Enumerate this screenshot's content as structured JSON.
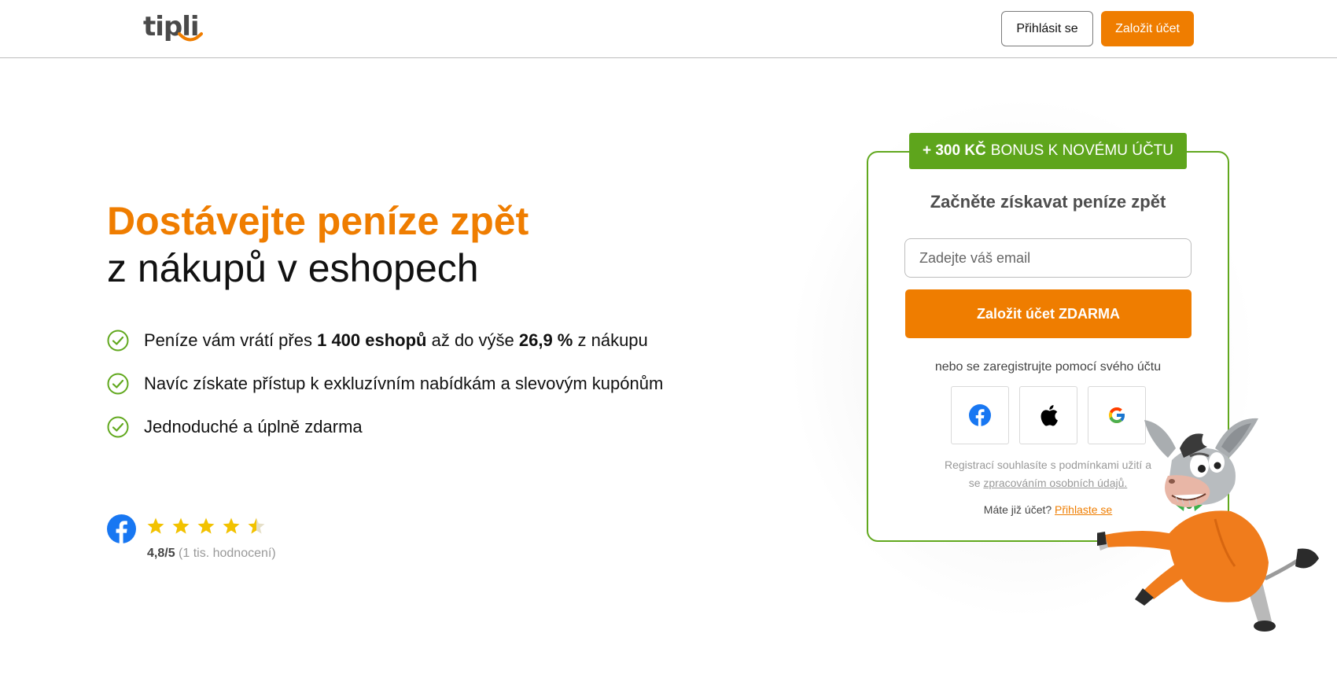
{
  "header": {
    "logo_text": "tipli",
    "login_label": "Přihlásit se",
    "register_label": "Založit účet"
  },
  "hero": {
    "headline_highlight": "Dostávejte peníze zpět",
    "headline_rest": "z nákupů v eshopech",
    "features": {
      "f1": {
        "pre": "Peníze vám vrátí přes ",
        "shops": "1 400 eshopů",
        "mid": " až do výše ",
        "percent": "26,9 %",
        "post": " z nákupu"
      },
      "f2": "Navíc získate přístup k exkluzívním nabídkám a slevovým kupónům",
      "f3": "Jednoduché a úplně zdarma"
    },
    "rating": {
      "score": "4,8/5",
      "count": "(1 tis. hodnocení)",
      "stars_value": 4.5,
      "stars_max": 5
    }
  },
  "signup": {
    "bonus_strong": "+ 300 KČ",
    "bonus_rest": "BONUS K NOVÉMU ÚČTU",
    "title": "Začněte získavat peníze zpět",
    "email_placeholder": "Zadejte váš email",
    "cta_label": "Založit účet ZDARMA",
    "or_text": "nebo se zaregistrujte pomocí svého účtu",
    "terms_line1": "Registrací souhlasíte s podmínkami užití a",
    "terms_line2_pre": "se ",
    "terms_link": "zpracováním osobních údajů.",
    "have_account": "Máte již účet?",
    "login_link": "Přihlaste se"
  },
  "colors": {
    "accent": "#ef7d00",
    "green": "#5ea51c",
    "facebook": "#1877f2"
  }
}
